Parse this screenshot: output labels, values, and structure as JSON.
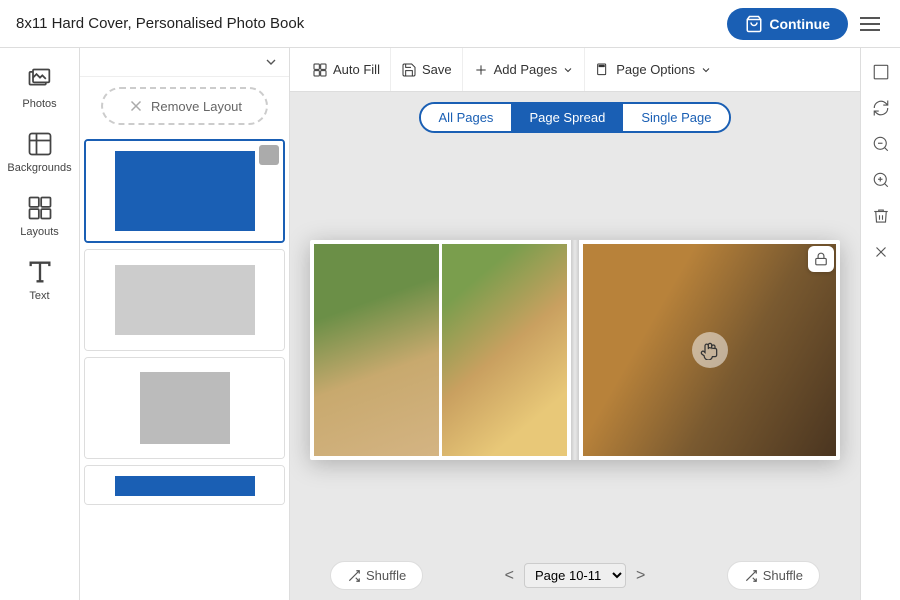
{
  "header": {
    "title": "8x11 Hard Cover, Personalised Photo Book",
    "continue_label": "Continue"
  },
  "toolbar": {
    "auto_fill_label": "Auto Fill",
    "save_label": "Save",
    "add_pages_label": "Add Pages",
    "page_options_label": "Page Options"
  },
  "view_toggle": {
    "all_pages_label": "All Pages",
    "page_spread_label": "Page Spread",
    "single_page_label": "Single Page",
    "active": "page_spread"
  },
  "sidebar": {
    "items": [
      {
        "id": "photos",
        "label": "Photos"
      },
      {
        "id": "backgrounds",
        "label": "Backgrounds"
      },
      {
        "id": "layouts",
        "label": "Layouts"
      },
      {
        "id": "text",
        "label": "Text"
      }
    ]
  },
  "panel": {
    "remove_layout_label": "Remove Layout"
  },
  "page_nav": {
    "page_label": "Page 10-11",
    "prev_label": "<",
    "next_label": ">"
  },
  "shuffle_label": "Shuffle",
  "layouts": [
    {
      "id": "blue-full",
      "type": "blue-full"
    },
    {
      "id": "gray-full",
      "type": "gray-full"
    },
    {
      "id": "gray-portrait",
      "type": "gray-portrait"
    },
    {
      "id": "blue-strip",
      "type": "blue-strip"
    }
  ]
}
